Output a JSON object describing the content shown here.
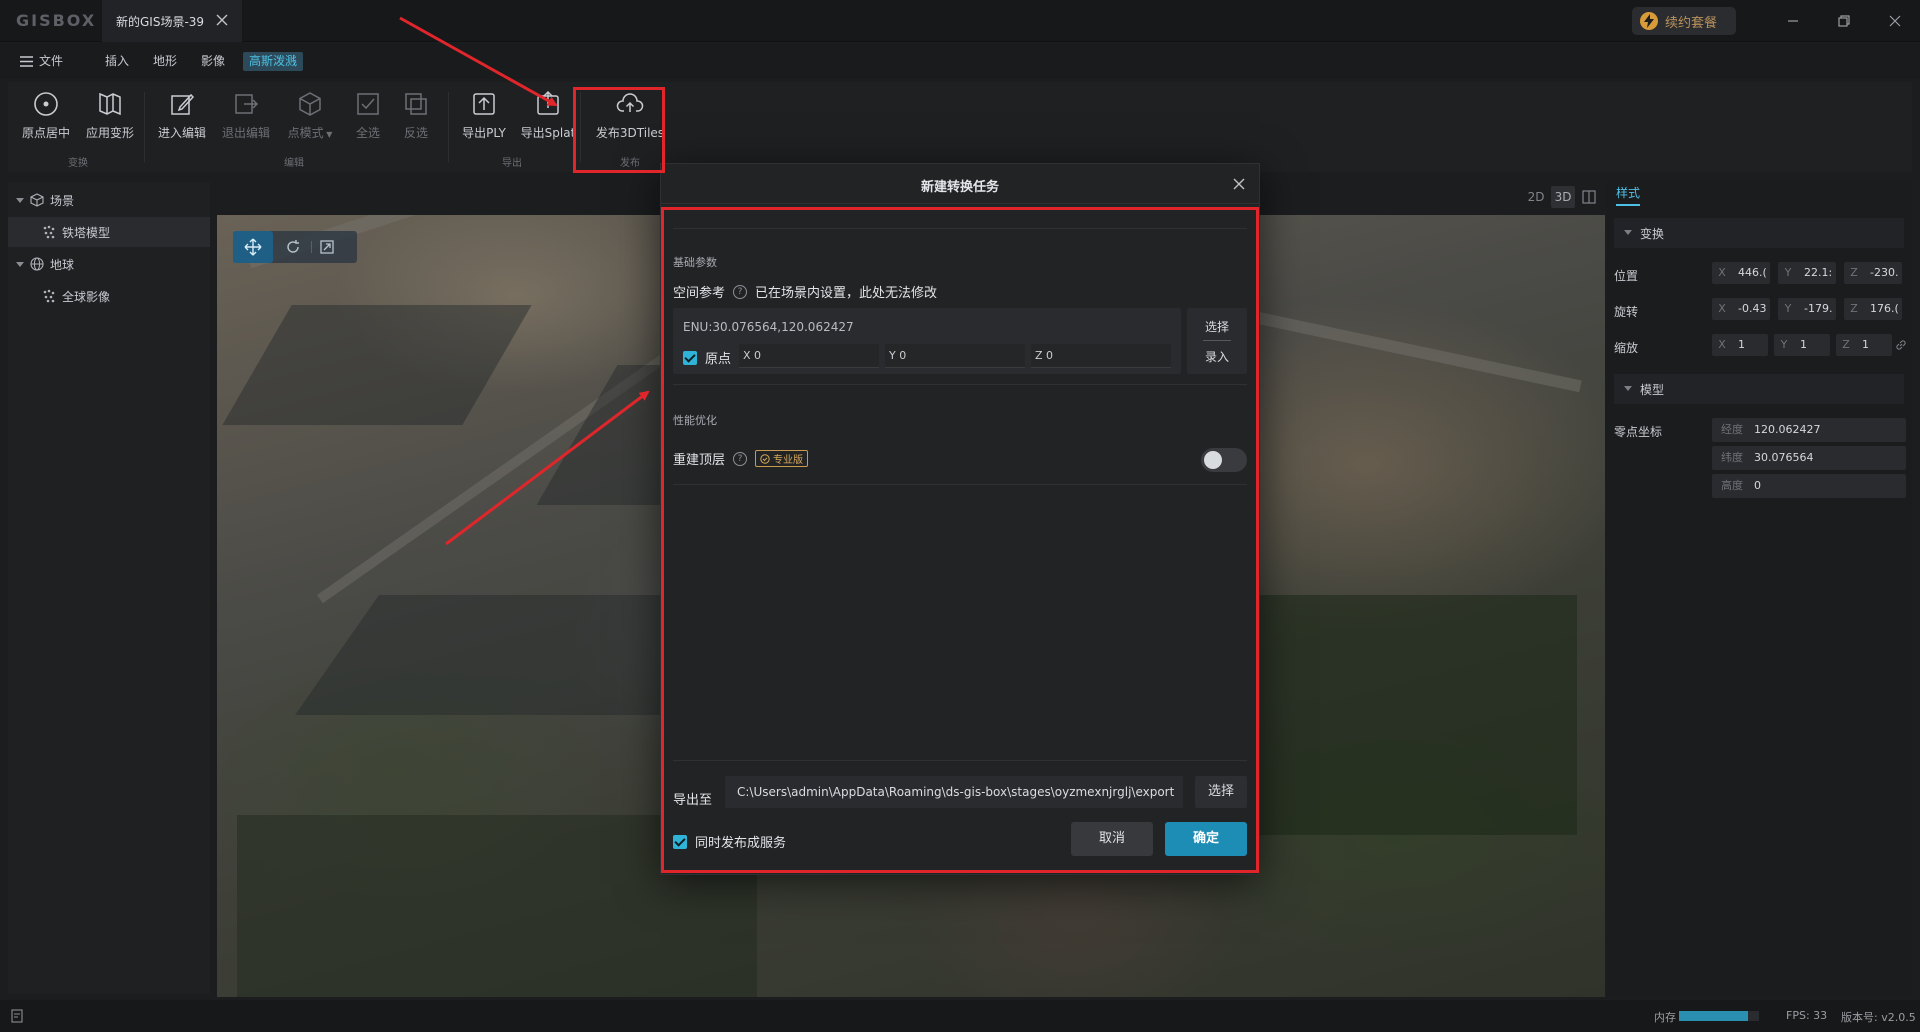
{
  "app": {
    "logo": "GISBOX",
    "tab_title": "新的GIS场景-39",
    "plan_button": "续约套餐"
  },
  "menu": {
    "file": "文件",
    "insert": "插入",
    "terrain": "地形",
    "imagery": "影像",
    "gaussian": "高斯泼溅"
  },
  "toolbar": {
    "center_origin": "原点居中",
    "apply_transform": "应用变形",
    "enter_edit": "进入编辑",
    "exit_edit": "退出编辑",
    "point_mode": "点模式",
    "select_all": "全选",
    "invert": "反选",
    "export_ply": "导出PLY",
    "export_splat": "导出Splat",
    "publish_3dtiles": "发布3DTiles",
    "group_transform": "变换",
    "group_edit": "编辑",
    "group_export": "导出",
    "group_publish": "发布"
  },
  "tree": {
    "scene": "场景",
    "tower_model": "铁塔模型",
    "globe": "地球",
    "global_imagery": "全球影像"
  },
  "viewmodes": {
    "two_d": "2D",
    "three_d": "3D"
  },
  "properties": {
    "style_tab": "样式",
    "transform_header": "变换",
    "position_label": "位置",
    "rotation_label": "旋转",
    "scale_label": "缩放",
    "model_header": "模型",
    "origin_label": "零点坐标",
    "position": {
      "x": "446.(",
      "y": "22.1:",
      "z": "-230."
    },
    "rotation": {
      "x": "-0.43",
      "y": "-179.",
      "z": "176.("
    },
    "scale": {
      "x": "1",
      "y": "1",
      "z": "1"
    },
    "longitude_label": "经度",
    "longitude": "120.062427",
    "latitude_label": "纬度",
    "latitude": "30.076564",
    "height_label": "高度",
    "height": "0"
  },
  "status": {
    "memory_label": "内存",
    "memory_level": 0.86,
    "fps": "FPS: 33",
    "version": "版本号: v2.0.5"
  },
  "dialog": {
    "title": "新建转换任务",
    "basic_section": "基础参数",
    "spatial_label": "空间参考",
    "spatial_note": "已在场景内设置，此处无法修改",
    "enu": "ENU:30.076564,120.062427",
    "origin_label": "原点",
    "origin_x": "X 0",
    "origin_y": "Y 0",
    "origin_z": "Z 0",
    "pick_select": "选择",
    "pick_enter": "录入",
    "perf_section": "性能优化",
    "rebuild_label": "重建顶层",
    "pro_badge": "专业版",
    "export_label": "导出至",
    "export_path": "C:\\Users\\admin\\AppData\\Roaming\\ds-gis-box\\stages\\oyzmexnjrglj\\export",
    "export_select": "选择",
    "publish_service": "同时发布成服务",
    "cancel": "取消",
    "ok": "确定"
  },
  "colors": {
    "accent": "#1d8db5",
    "annotation_red": "#e0262b"
  }
}
